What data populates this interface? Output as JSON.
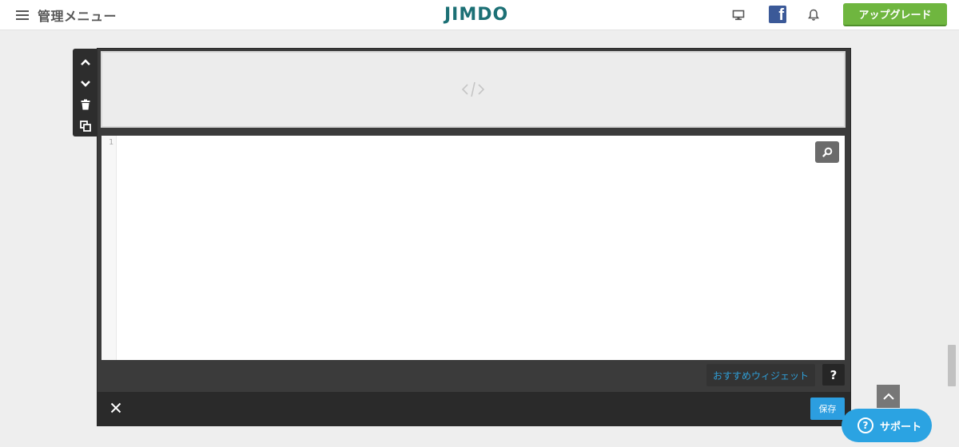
{
  "header": {
    "menu_label": "管理メニュー",
    "logo_text": "JIMDO",
    "facebook_letter": "f",
    "upgrade_label": "アップグレード",
    "icons": [
      "hamburger-icon",
      "monitor-icon",
      "facebook-icon",
      "bell-icon"
    ]
  },
  "side_tools": {
    "icons": [
      "chevron-up-icon",
      "chevron-down-icon",
      "trash-icon",
      "copy-icon"
    ]
  },
  "editor": {
    "preview_icon": "code-icon",
    "line_numbers": [
      "1"
    ],
    "widget_button_label": "おすすめウィジェット",
    "help_label": "?",
    "save_label": "保存",
    "close_icon": "close-icon",
    "search_icon": "search-icon"
  },
  "floating": {
    "support_label": "サポート",
    "support_icon_label": "?",
    "scroll_top_icon": "chevron-up-icon"
  },
  "colors": {
    "brand": "#1c7075",
    "upgrade_green": "#6fb63f",
    "save_blue": "#2c9ee0",
    "support_blue": "#2ba3e2",
    "widget_link": "#2f9fd8"
  }
}
